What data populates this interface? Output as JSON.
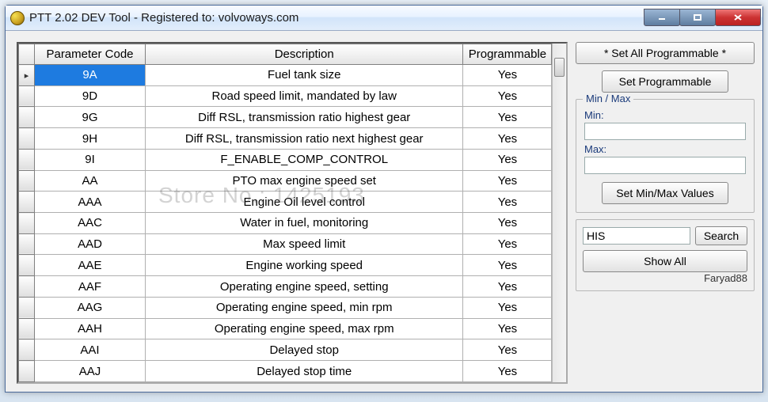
{
  "window": {
    "title": "PTT 2.02 DEV Tool - Registered to: volvoways.com"
  },
  "table": {
    "headers": {
      "code": "Parameter Code",
      "desc": "Description",
      "prog": "Programmable"
    },
    "rows": [
      {
        "code": "9A",
        "desc": "Fuel tank size",
        "prog": "Yes",
        "selected": true
      },
      {
        "code": "9D",
        "desc": "Road speed limit, mandated by law",
        "prog": "Yes"
      },
      {
        "code": "9G",
        "desc": "Diff RSL, transmission ratio highest gear",
        "prog": "Yes"
      },
      {
        "code": "9H",
        "desc": "Diff RSL, transmission ratio next highest gear",
        "prog": "Yes"
      },
      {
        "code": "9I",
        "desc": "F_ENABLE_COMP_CONTROL",
        "prog": "Yes"
      },
      {
        "code": "AA",
        "desc": "PTO max engine speed set",
        "prog": "Yes"
      },
      {
        "code": "AAA",
        "desc": "Engine Oil level control",
        "prog": "Yes"
      },
      {
        "code": "AAC",
        "desc": "Water in fuel, monitoring",
        "prog": "Yes"
      },
      {
        "code": "AAD",
        "desc": "Max speed limit",
        "prog": "Yes"
      },
      {
        "code": "AAE",
        "desc": "Engine working speed",
        "prog": "Yes"
      },
      {
        "code": "AAF",
        "desc": "Operating engine speed, setting",
        "prog": "Yes"
      },
      {
        "code": "AAG",
        "desc": "Operating engine speed, min rpm",
        "prog": "Yes"
      },
      {
        "code": "AAH",
        "desc": "Operating engine speed, max rpm",
        "prog": "Yes"
      },
      {
        "code": "AAI",
        "desc": "Delayed stop",
        "prog": "Yes"
      },
      {
        "code": "AAJ",
        "desc": "Delayed stop time",
        "prog": "Yes"
      }
    ]
  },
  "side": {
    "set_all": "* Set All Programmable *",
    "set_prog": "Set Programmable",
    "group_title": "Min / Max",
    "min_label": "Min:",
    "max_label": "Max:",
    "min_value": "",
    "max_value": "",
    "set_minmax": "Set Min/Max Values",
    "search_value": "HIS",
    "search_btn": "Search",
    "show_all": "Show All",
    "credit": "Faryad88"
  },
  "watermark": "Store No.: 1425193"
}
